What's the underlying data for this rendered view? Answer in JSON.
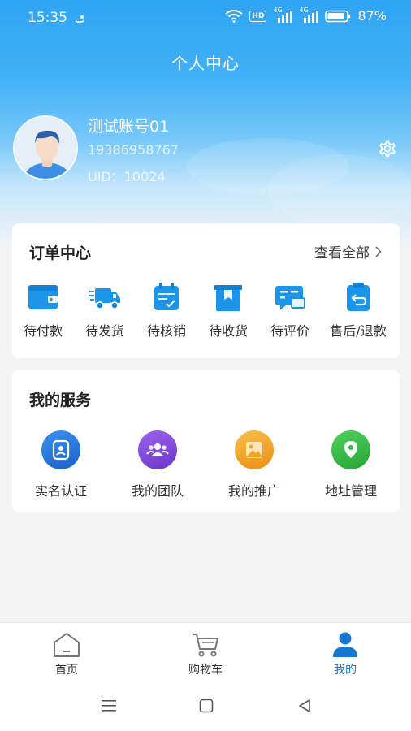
{
  "status_bar": {
    "time": "15:35",
    "network_badge": "HD",
    "signal1_label": "4G",
    "signal2_label": "4G",
    "battery": "87%"
  },
  "header": {
    "title": "个人中心"
  },
  "profile": {
    "name": "测试账号01",
    "phone": "19386958767",
    "uid": "UID：10024",
    "avatar_icon": "user-avatar",
    "settings_icon": "gear-icon"
  },
  "orders": {
    "title": "订单中心",
    "view_all": "查看全部",
    "items": [
      {
        "label": "待付款",
        "icon": "wallet-icon"
      },
      {
        "label": "待发货",
        "icon": "truck-icon"
      },
      {
        "label": "待核销",
        "icon": "calendar-check-icon"
      },
      {
        "label": "待收货",
        "icon": "package-icon"
      },
      {
        "label": "待评价",
        "icon": "comment-icon"
      },
      {
        "label": "售后/退款",
        "icon": "return-icon"
      }
    ]
  },
  "services": {
    "title": "我的服务",
    "items": [
      {
        "label": "实名认证",
        "icon": "id-card-icon",
        "color": "#2b7de9"
      },
      {
        "label": "我的团队",
        "icon": "team-icon",
        "color": "#8a4fe0"
      },
      {
        "label": "我的推广",
        "icon": "image-icon",
        "color": "#f0a21c"
      },
      {
        "label": "地址管理",
        "icon": "location-icon",
        "color": "#3bbf4a"
      }
    ]
  },
  "tabbar": {
    "items": [
      {
        "label": "首页",
        "icon": "home-icon"
      },
      {
        "label": "购物车",
        "icon": "cart-icon"
      },
      {
        "label": "我的",
        "icon": "person-icon"
      }
    ],
    "active": "我的"
  },
  "colors": {
    "accent": "#2196f3",
    "icon_blue": "#1a95ea",
    "tab_active": "#1677d2"
  }
}
